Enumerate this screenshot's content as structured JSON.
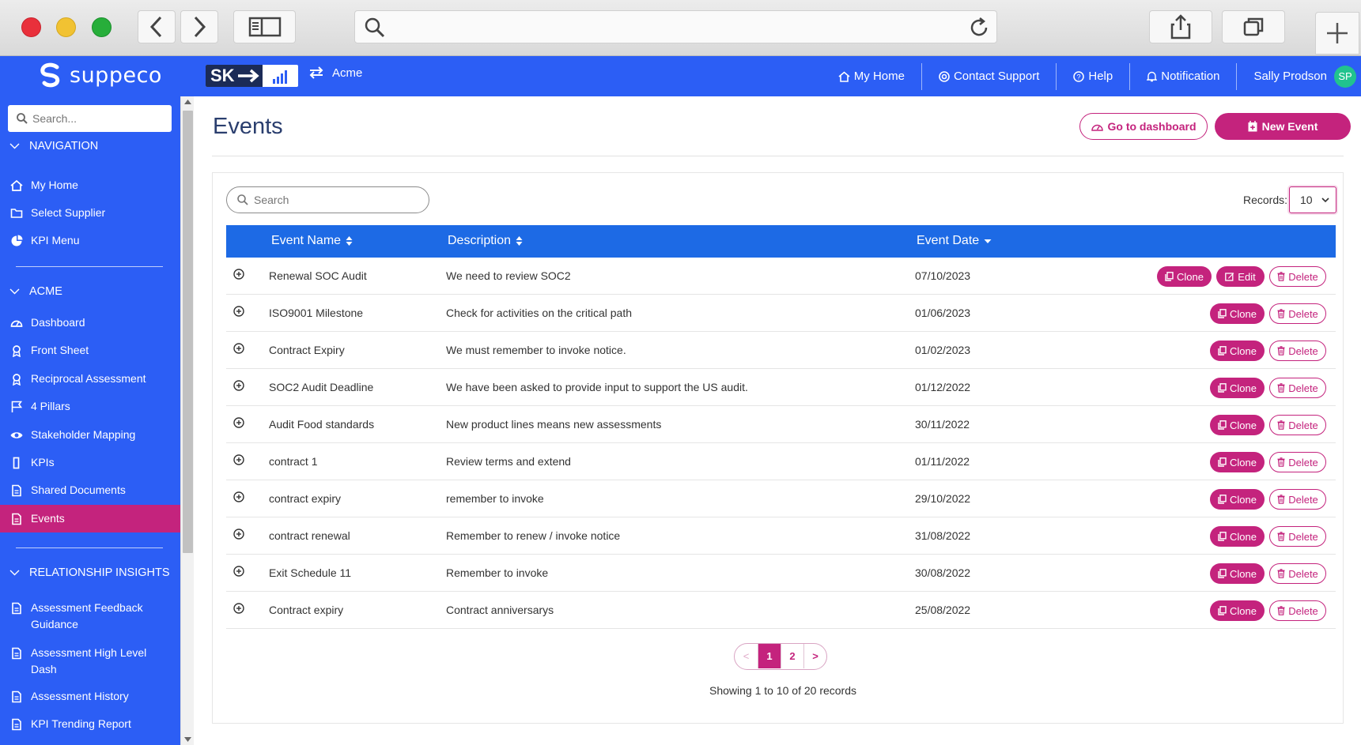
{
  "browser": {
    "controls": [
      "close",
      "minimize",
      "zoom"
    ]
  },
  "header": {
    "brand": "suppeco",
    "org_logo_text": "SK",
    "org_name": "Acme",
    "nav": [
      {
        "label": "My Home",
        "icon": "home-icon"
      },
      {
        "label": "Contact Support",
        "icon": "support-icon"
      },
      {
        "label": "Help",
        "icon": "help-icon"
      },
      {
        "label": "Notification",
        "icon": "bell-icon"
      }
    ],
    "user": {
      "name": "Sally Prodson",
      "initials": "SP"
    }
  },
  "sidebar": {
    "search_placeholder": "Search...",
    "sections": [
      {
        "title": "NAVIGATION"
      },
      {
        "title": "ACME"
      },
      {
        "title": "RELATIONSHIP INSIGHTS"
      }
    ],
    "navigation": [
      {
        "label": "My Home",
        "icon": "home-icon"
      },
      {
        "label": "Select Supplier",
        "icon": "folder-icon"
      },
      {
        "label": "KPI Menu",
        "icon": "pie-chart-icon"
      }
    ],
    "acme": [
      {
        "label": "Dashboard",
        "icon": "gauge-icon"
      },
      {
        "label": "Front Sheet",
        "icon": "award-icon"
      },
      {
        "label": "Reciprocal Assessment",
        "icon": "award-icon"
      },
      {
        "label": "4 Pillars",
        "icon": "flag-icon"
      },
      {
        "label": "Stakeholder Mapping",
        "icon": "eye-icon"
      },
      {
        "label": "KPIs",
        "icon": "bar-icon"
      },
      {
        "label": "Shared Documents",
        "icon": "document-icon"
      },
      {
        "label": "Events",
        "icon": "document-icon",
        "active": true
      }
    ],
    "insights": [
      {
        "label": "Assessment Feedback Guidance",
        "icon": "document-icon"
      },
      {
        "label": "Assessment High Level Dash",
        "icon": "document-icon"
      },
      {
        "label": "Assessment History",
        "icon": "document-icon"
      },
      {
        "label": "KPI Trending Report",
        "icon": "document-icon"
      }
    ]
  },
  "main": {
    "title": "Events",
    "go_dashboard_label": "Go to dashboard",
    "new_event_label": "New Event",
    "search_placeholder": "Search",
    "records_label": "Records:",
    "records_value": "10",
    "columns": [
      "Event Name",
      "Description",
      "Event Date"
    ],
    "rows": [
      {
        "name": "Renewal SOC Audit",
        "description": "We need to review SOC2",
        "date": "07/10/2023",
        "editable": true
      },
      {
        "name": "ISO9001 Milestone",
        "description": "Check for activities on the critical path",
        "date": "01/06/2023"
      },
      {
        "name": "Contract Expiry",
        "description": "We must remember to invoke notice.",
        "date": "01/02/2023"
      },
      {
        "name": "SOC2 Audit Deadline",
        "description": "We have been asked to provide input to support the US audit.",
        "date": "01/12/2022"
      },
      {
        "name": "Audit Food standards",
        "description": "New product lines means new assessments",
        "date": "30/11/2022"
      },
      {
        "name": "contract 1",
        "description": "Review terms and extend",
        "date": "01/11/2022"
      },
      {
        "name": "contract expiry",
        "description": "remember to invoke",
        "date": "29/10/2022"
      },
      {
        "name": "contract renewal",
        "description": "Remember to renew / invoke notice",
        "date": "31/08/2022"
      },
      {
        "name": "Exit Schedule 11",
        "description": "Remember to invoke",
        "date": "30/08/2022"
      },
      {
        "name": "Contract expiry",
        "description": "Contract anniversarys",
        "date": "25/08/2022"
      }
    ],
    "actions": {
      "clone": "Clone",
      "edit": "Edit",
      "delete": "Delete"
    },
    "pagination": {
      "prev": "<",
      "pages": [
        "1",
        "2"
      ],
      "current": "1",
      "next": ">"
    },
    "showing_text": "Showing 1 to 10 of 20 records"
  },
  "colors": {
    "primary_blue": "#2c5ef5",
    "table_header_blue": "#1d6ae5",
    "accent_magenta": "#c4237d",
    "avatar_green": "#21c38e"
  }
}
